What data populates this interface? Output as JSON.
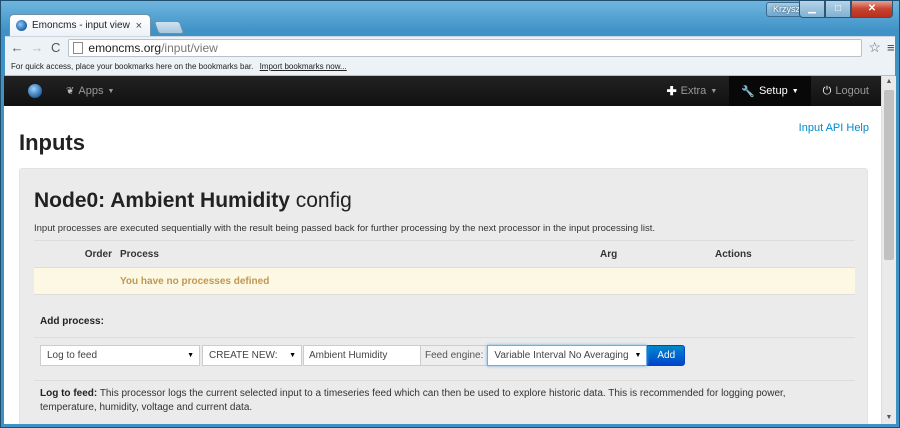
{
  "window": {
    "user": "Krzysztof",
    "min_glyph": "▁",
    "max_glyph": "□",
    "close_glyph": "✕"
  },
  "tab": {
    "title": "Emoncms - input view",
    "close": "×"
  },
  "toolbar": {
    "back": "←",
    "forward": "→",
    "reload": "C",
    "url_host": "emoncms.org",
    "url_path": "/input/view",
    "star": "☆",
    "menu": "≡"
  },
  "bookmarks_bar": {
    "message": "For quick access, place your bookmarks here on the bookmarks bar.",
    "import_link": "Import bookmarks now..."
  },
  "app_nav": {
    "apps_label": "Apps",
    "extra_label": "Extra",
    "setup_label": "Setup",
    "logout_label": "Logout"
  },
  "page": {
    "api_help": "Input API Help",
    "title": "Inputs",
    "node_title_bold": "Node0: Ambient Humidity",
    "node_title_suffix": "config",
    "description": "Input processes are executed sequentially with the result being passed back for further processing by the next processor in the input processing list.",
    "table": {
      "headers": [
        "Order",
        "Process",
        "Arg",
        "Actions"
      ],
      "empty_message": "You have no processes defined"
    },
    "add_process": {
      "label": "Add process:",
      "process_select": "Log to feed",
      "feed_select": "CREATE NEW:",
      "feed_name": "Ambient Humidity",
      "engine_label": "Feed engine:",
      "engine_select": "Variable Interval No Averaging",
      "add_button": "Add"
    },
    "info": {
      "title": "Log to feed:",
      "text": "This processor logs the current selected input to a timeseries feed which can then be used to explore historic data. This is recommended for logging power, temperature, humidity, voltage and current data."
    }
  },
  "colors": {
    "nav_bg": "#111111",
    "link": "#0088cc",
    "warning_bg": "#fcf8e3",
    "warning_text": "#c09853",
    "button_primary": "#0066cc"
  }
}
